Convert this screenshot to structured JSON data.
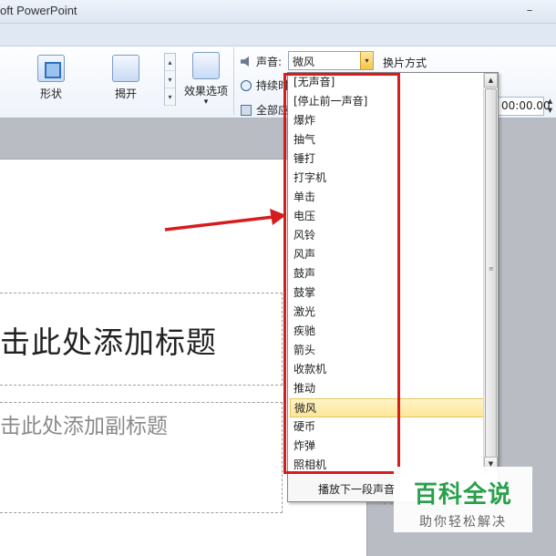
{
  "window": {
    "title": "oft PowerPoint",
    "minimize_glyph": "–"
  },
  "ribbon": {
    "shape_label": "形状",
    "reveal_label": "揭开",
    "effect_options_label": "效果选项",
    "effect_options_arrow": "▾",
    "gallery_arrows": [
      "▴",
      "▾",
      "▾"
    ],
    "sound_label": "声音:",
    "sound_value": "微风",
    "duration_label": "持续时",
    "apply_all_label": "全部应",
    "switch_mode_label": "换片方式",
    "time_value": "00:00.00",
    "spinner_up": "▲",
    "spinner_down": "▼"
  },
  "icons": {
    "sound": "speaker-icon",
    "duration": "clock-icon",
    "apply_all": "apply-all-icon",
    "shape": "shape-effect-icon",
    "reveal": "reveal-effect-icon",
    "effect_options": "effect-options-icon"
  },
  "slide": {
    "title_placeholder": "击此处添加标题",
    "subtitle_placeholder": "击此处添加副标题"
  },
  "sound_dropdown": {
    "items": [
      {
        "label": "[无声音]"
      },
      {
        "label": "[停止前一声音]"
      },
      {
        "label": "爆炸"
      },
      {
        "label": "抽气"
      },
      {
        "label": "锤打"
      },
      {
        "label": "打字机"
      },
      {
        "label": "单击"
      },
      {
        "label": "电压"
      },
      {
        "label": "风铃"
      },
      {
        "label": "风声"
      },
      {
        "label": "鼓声"
      },
      {
        "label": "鼓掌"
      },
      {
        "label": "激光"
      },
      {
        "label": "疾驰"
      },
      {
        "label": "箭头"
      },
      {
        "label": "收款机"
      },
      {
        "label": "推动"
      },
      {
        "label": "微风"
      },
      {
        "label": "硬币"
      },
      {
        "label": "炸弹"
      },
      {
        "label": "照相机"
      }
    ],
    "selected": "微风",
    "footer_item": "播放下一段声音",
    "scroll_up": "▲",
    "scroll_down": "▼",
    "scroll_grip": "≡",
    "resize_grip": "∙∙∙∙"
  },
  "annotation": {
    "color": "#d61d1d"
  },
  "watermark": {
    "main": "百科全说",
    "sub": "助你轻松解决",
    "color": "#29a04b"
  }
}
